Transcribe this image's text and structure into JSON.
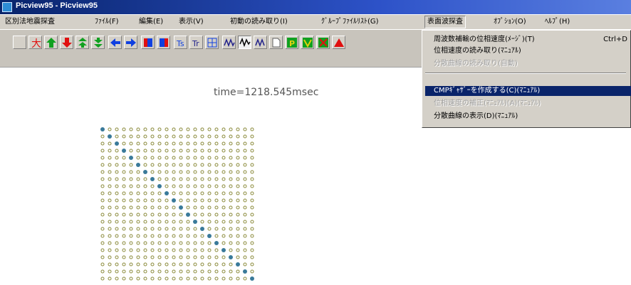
{
  "window": {
    "title": "Picview95 - Picview95",
    "icon": "app-icon"
  },
  "menubar": {
    "items": [
      "区別法地震探査",
      "ﾌｧｲﾙ(F)",
      "編集(E)",
      "表示(V)",
      "初動の読み取り(I)",
      "ｸﾞﾙｰﾌﾟﾌｧｲﾙﾘｽﾄ(G)",
      "表面波探査",
      "ｵﾌﾟｼｮﾝ(O)",
      "ﾍﾙﾌﾟ(H)"
    ]
  },
  "toolbar": {
    "buttons": [
      "blank-icon",
      "kanji-icon",
      "arrow-up-icon",
      "arrow-down-icon",
      "double-up-icon",
      "double-down-icon",
      "arrow-left-icon",
      "arrow-right-icon",
      "block-icon",
      "block2-icon",
      "tt-icon",
      "tt2-icon",
      "grid-icon",
      "wave-icon",
      "wave-a-icon",
      "wave-b-icon",
      "doc-icon",
      "p-icon",
      "v-icon",
      "x-icon",
      "triangle-icon"
    ],
    "colors": {
      "red": "#e01010",
      "green": "#10a020",
      "blue": "#1040e0",
      "navy": "#20208a"
    }
  },
  "main": {
    "time_text": "time=1218.545msec"
  },
  "dropdown": {
    "items": [
      {
        "label": "周波数補輸の位相速度(ﾒｰｼﾞ)(T)",
        "shortcut": "Ctrl+D",
        "state": "normal"
      },
      {
        "label": "位相速度の読み取り(ﾏﾆｭｱﾙ)",
        "shortcut": "",
        "state": "normal"
      },
      {
        "label": "分散曲線の読み取り(自動)",
        "shortcut": "",
        "state": "disabled"
      },
      {
        "label": "",
        "shortcut": "",
        "state": "separator"
      },
      {
        "label": "CMPｷﾞｬｻﾞｰを作成する(C)(ﾏﾆｭｱﾙ)",
        "shortcut": "",
        "state": "selected"
      },
      {
        "label": "位相速度の補正(ﾏﾆｭｱﾙ)(A)(ﾏﾆｭｱﾙ)",
        "shortcut": "",
        "state": "disabled"
      },
      {
        "label": "分散曲線の表示(D)(ﾏﾆｭｱﾙ)",
        "shortcut": "",
        "state": "normal"
      }
    ]
  },
  "matrix": {
    "rows": 22,
    "cols": 22,
    "cell_color": "#8a8a3a",
    "diag_color": "#3a7a9a"
  }
}
